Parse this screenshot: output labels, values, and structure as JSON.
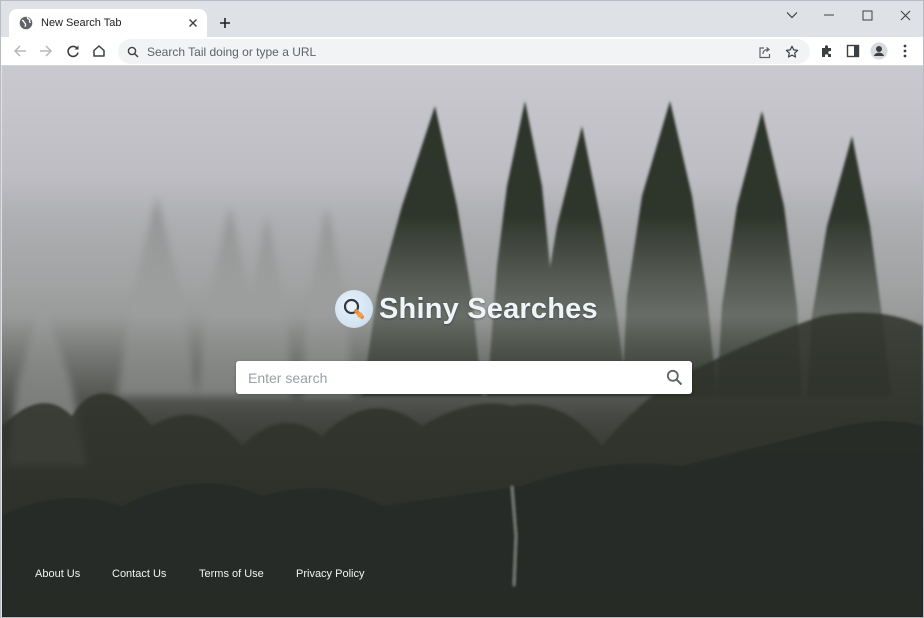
{
  "browser": {
    "tab": {
      "title": "New Search Tab",
      "favicon": "globe-icon",
      "close_icon": "close-icon"
    },
    "new_tab_icon": "plus-icon",
    "window_controls": [
      "chevron-down-icon",
      "minimize-icon",
      "maximize-icon",
      "close-icon"
    ],
    "nav": [
      "back-arrow-icon",
      "forward-arrow-icon",
      "reload-icon",
      "home-icon"
    ],
    "omnibox": {
      "placeholder": "Search Tail doing or type a URL",
      "left_icon": "search-icon",
      "right_icons": [
        "share-icon",
        "star-icon"
      ]
    },
    "toolbar_icons": [
      "extensions-puzzle-icon",
      "side-panel-icon",
      "profile-avatar-icon",
      "kebab-menu-icon"
    ]
  },
  "page": {
    "brand": {
      "name": "Shiny Searches",
      "logo": "magnifier-logo-icon"
    },
    "search": {
      "placeholder": "Enter search",
      "value": "",
      "button_icon": "search-icon"
    },
    "footer_links": [
      {
        "label": "About Us"
      },
      {
        "label": "Contact Us"
      },
      {
        "label": "Terms of Use"
      },
      {
        "label": "Privacy Policy"
      }
    ]
  },
  "colors": {
    "chrome_frame": "#dee1e6",
    "toolbar": "#ffffff",
    "omnibox": "#f1f3f4",
    "brand_text": "#eef4f8",
    "footer_text": "#f2f2f2"
  }
}
